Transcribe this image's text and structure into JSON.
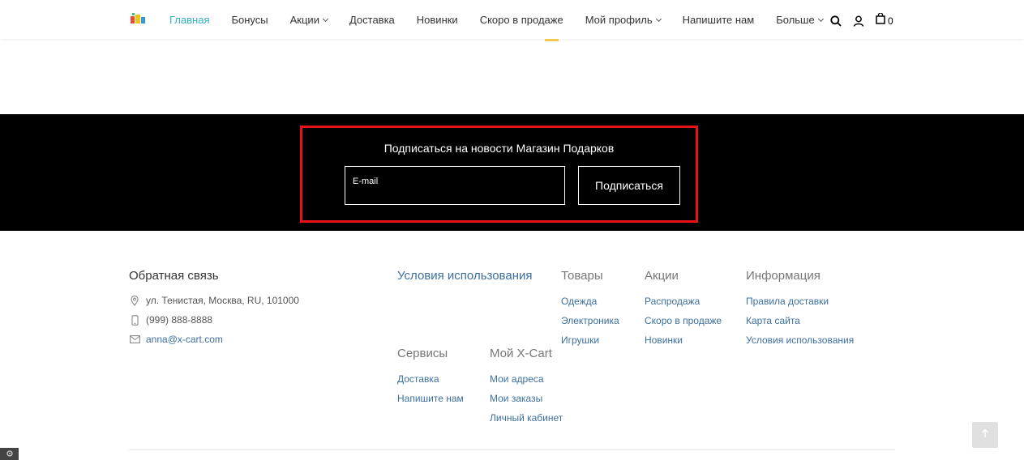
{
  "header": {
    "nav": [
      {
        "label": "Главная",
        "active": true,
        "dropdown": false
      },
      {
        "label": "Бонусы",
        "active": false,
        "dropdown": false
      },
      {
        "label": "Акции",
        "active": false,
        "dropdown": true
      },
      {
        "label": "Доставка",
        "active": false,
        "dropdown": false
      },
      {
        "label": "Новинки",
        "active": false,
        "dropdown": false
      },
      {
        "label": "Скоро в продаже",
        "active": false,
        "dropdown": false
      },
      {
        "label": "Мой профиль",
        "active": false,
        "dropdown": true
      },
      {
        "label": "Напишите нам",
        "active": false,
        "dropdown": false
      },
      {
        "label": "Больше",
        "active": false,
        "dropdown": true
      }
    ],
    "icons": [
      "search-icon",
      "user-icon",
      "cart-icon"
    ],
    "cart_count": "0",
    "accent_color": "#2fb0c2"
  },
  "subscribe": {
    "title": "Подписаться на новости Магазин Подарков",
    "email_placeholder": "E-mail",
    "button_label": "Подписаться",
    "highlight_color": "#e8121b"
  },
  "footer": {
    "contact": {
      "title": "Обратная связь",
      "address": "ул. Тенистая, Москва, RU, 101000",
      "phone": "(999) 888-8888",
      "email": "anna@x-cart.com"
    },
    "terms_title": "Условия использования",
    "services": {
      "title": "Сервисы",
      "links": [
        "Доставка",
        "Напишите нам"
      ]
    },
    "my_xcart": {
      "title": "Мой X-Cart",
      "links": [
        "Мои адреса",
        "Мои заказы",
        "Личный кабинет"
      ]
    },
    "products": {
      "title": "Товары",
      "links": [
        "Одежда",
        "Электроника",
        "Игрушки"
      ]
    },
    "sales": {
      "title": "Акции",
      "links": [
        "Распродажа",
        "Скоро в продаже",
        "Новинки"
      ]
    },
    "info": {
      "title": "Информация",
      "links": [
        "Правила доставки",
        "Карта сайта",
        "Условия использования"
      ]
    }
  }
}
